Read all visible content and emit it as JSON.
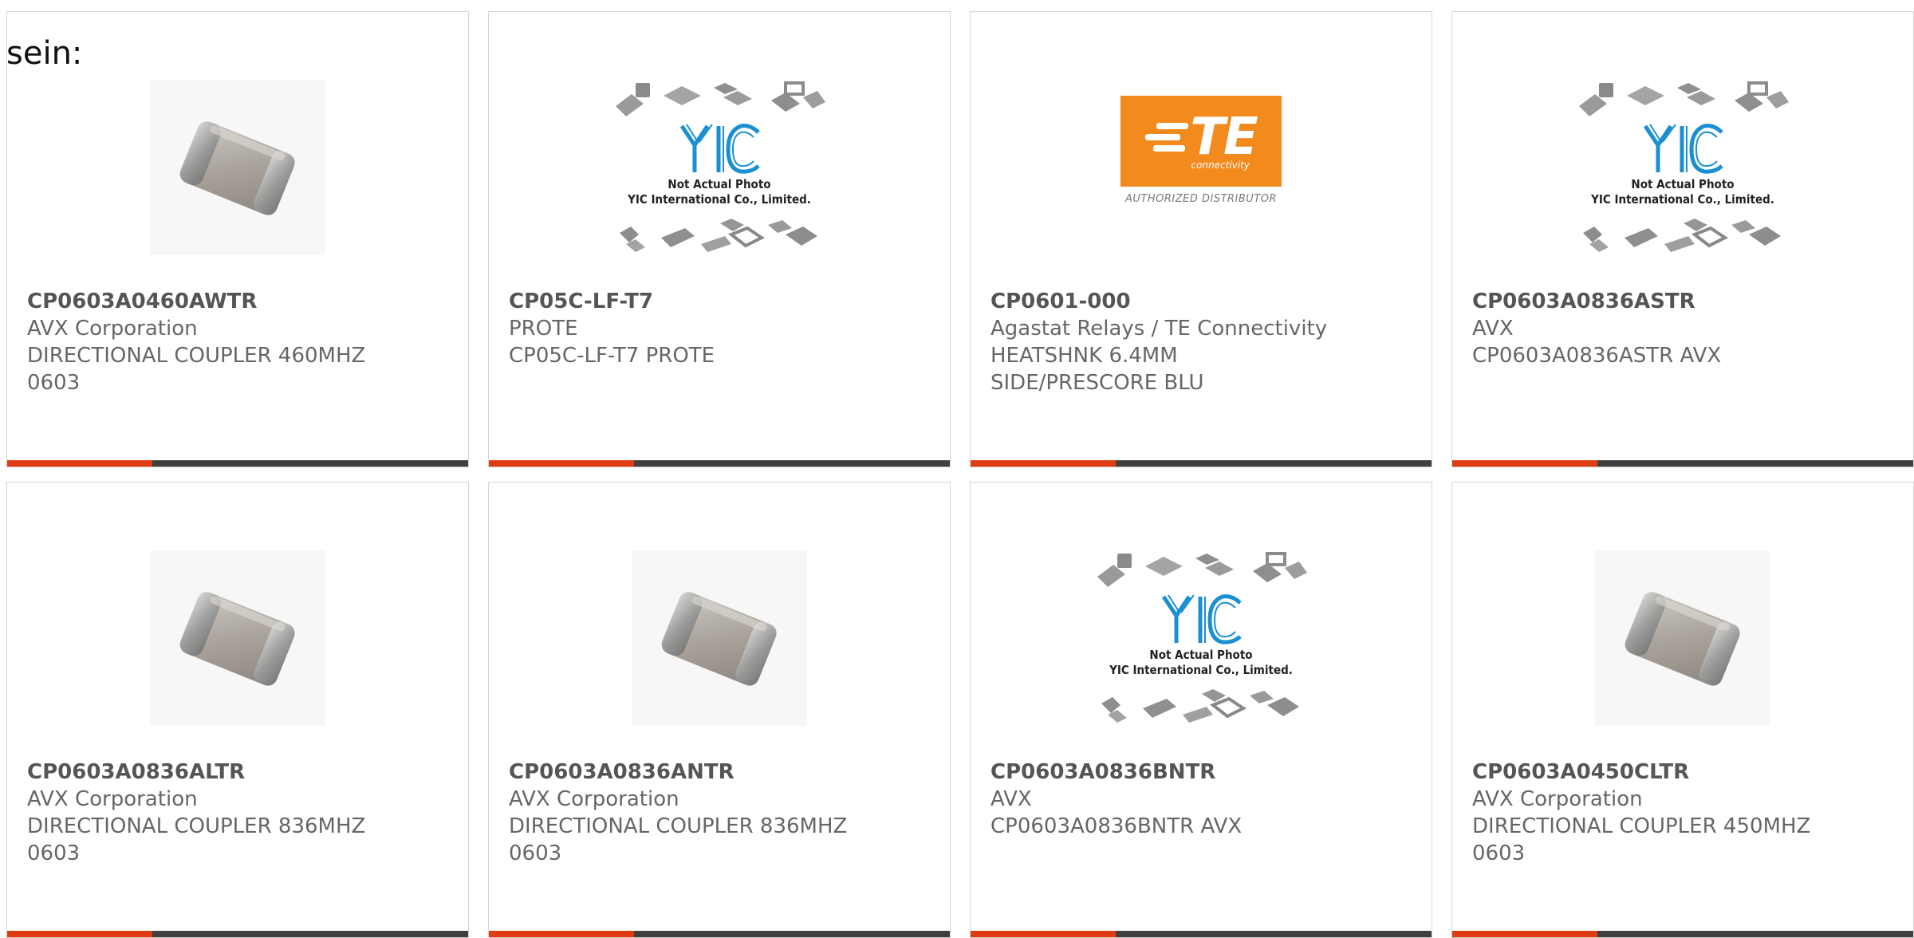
{
  "intro_text": "sein:",
  "placeholder": {
    "caption_line1": "Not Actual Photo",
    "caption_line2": "YIC International Co., Limited.",
    "logo_text": "YIC"
  },
  "te_logo": {
    "brand": "TE",
    "sub": "connectivity",
    "authorized": "AUTHORIZED DISTRIBUTOR"
  },
  "colors": {
    "accent": "#e03c14",
    "bar": "#3f3f3f",
    "te_orange": "#f28a1d",
    "yic_blue": "#1a8fd1"
  },
  "products": [
    {
      "part": "CP0603A0460AWTR",
      "maker": "AVX Corporation",
      "desc": "DIRECTIONAL COUPLER 460MHZ\n0603",
      "image": "chip-capacitor"
    },
    {
      "part": "CP05C-LF-T7",
      "maker": "PROTE",
      "desc": "CP05C-LF-T7 PROTE",
      "image": "yic-placeholder"
    },
    {
      "part": "CP0601-000",
      "maker": "Agastat Relays / TE Connectivity",
      "desc": "HEATSHNK 6.4MM\nSIDE/PRESCORE BLU",
      "image": "te-logo"
    },
    {
      "part": "CP0603A0836ASTR",
      "maker": "AVX",
      "desc": "CP0603A0836ASTR AVX",
      "image": "yic-placeholder"
    },
    {
      "part": "CP0603A0836ALTR",
      "maker": "AVX Corporation",
      "desc": "DIRECTIONAL COUPLER 836MHZ\n0603",
      "image": "chip-capacitor"
    },
    {
      "part": "CP0603A0836ANTR",
      "maker": "AVX Corporation",
      "desc": "DIRECTIONAL COUPLER 836MHZ\n0603",
      "image": "chip-capacitor"
    },
    {
      "part": "CP0603A0836BNTR",
      "maker": "AVX",
      "desc": "CP0603A0836BNTR AVX",
      "image": "yic-placeholder"
    },
    {
      "part": "CP0603A0450CLTR",
      "maker": "AVX Corporation",
      "desc": "DIRECTIONAL COUPLER 450MHZ\n0603",
      "image": "chip-capacitor"
    }
  ]
}
